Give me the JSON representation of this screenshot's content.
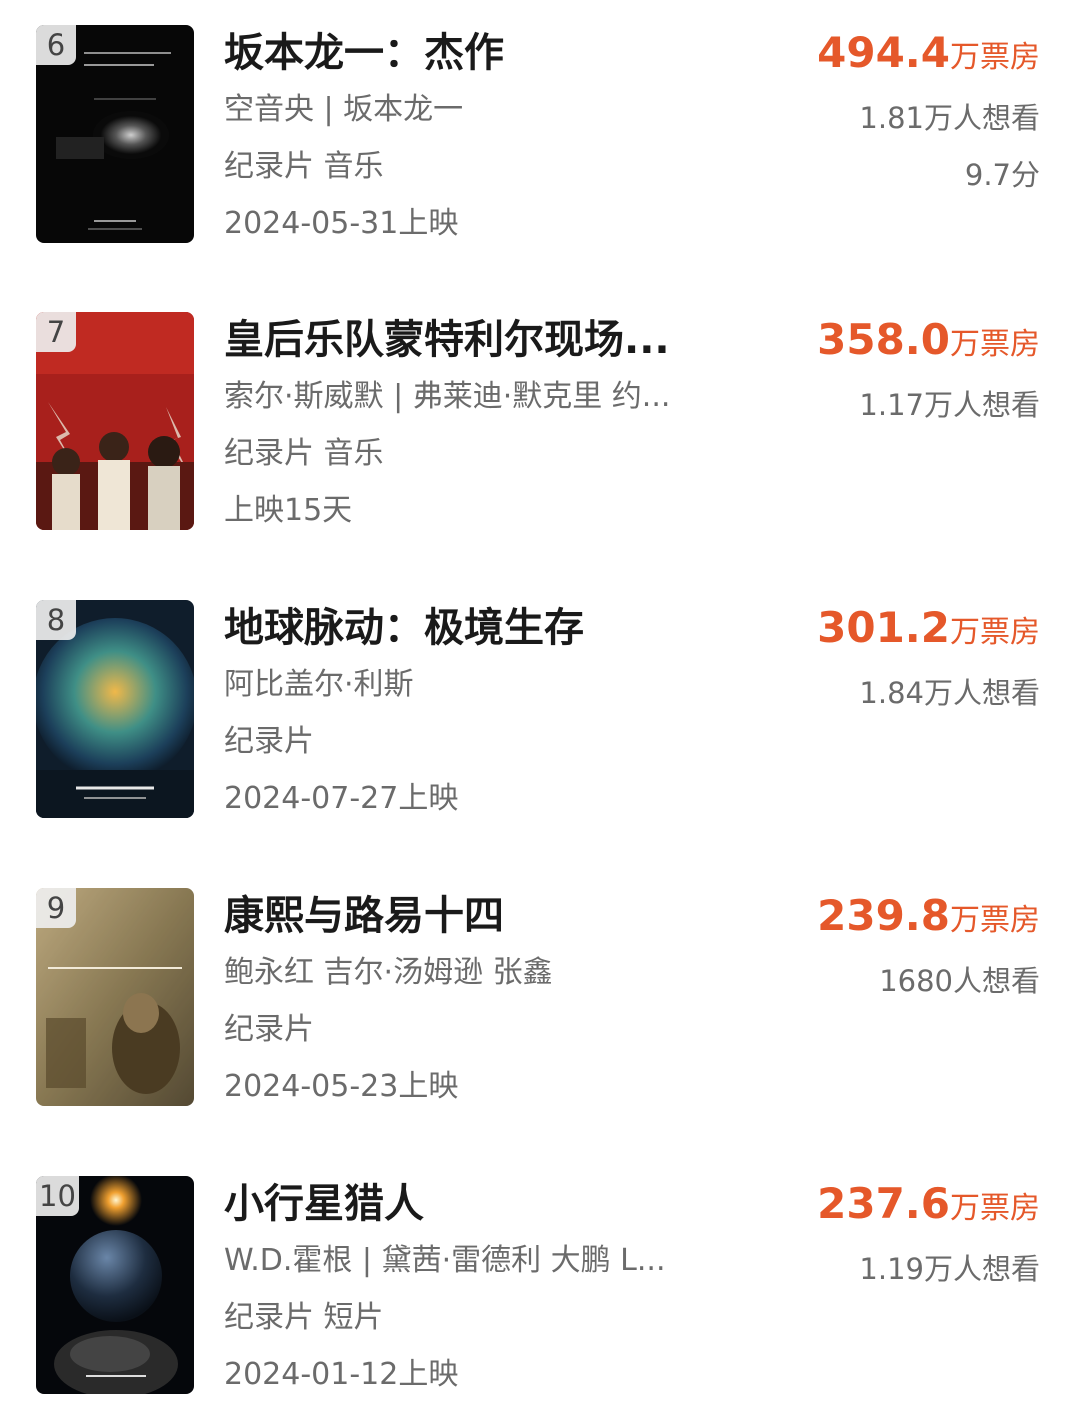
{
  "colors": {
    "accent": "#e5582a",
    "text_secondary": "#6b6b6b",
    "title": "#1a1a1a"
  },
  "movies": [
    {
      "rank": "6",
      "title": "坂本龙一：杰作",
      "people": "空音央 | 坂本龙一",
      "genre": "纪录片 音乐",
      "release": "2024-05-31上映",
      "box_office": "494.4",
      "box_office_unit": "万票房",
      "want": "1.81万人想看",
      "score": "9.7分",
      "poster_icon": "poster-ryuichi-sakamoto-opus"
    },
    {
      "rank": "7",
      "title": "皇后乐队蒙特利尔现场...",
      "people": "索尔·斯威默 | 弗莱迪·默克里 约...",
      "genre": "纪录片 音乐",
      "release": "上映15天",
      "box_office": "358.0",
      "box_office_unit": "万票房",
      "want": "1.17万人想看",
      "score": "",
      "poster_icon": "poster-queen-rock-montreal"
    },
    {
      "rank": "8",
      "title": "地球脉动：极境生存",
      "people": "阿比盖尔·利斯",
      "genre": "纪录片",
      "release": "2024-07-27上映",
      "box_office": "301.2",
      "box_office_unit": "万票房",
      "want": "1.84万人想看",
      "score": "",
      "poster_icon": "poster-planet-earth"
    },
    {
      "rank": "9",
      "title": "康熙与路易十四",
      "people": "鲍永红 吉尔·汤姆逊 张鑫",
      "genre": "纪录片",
      "release": "2024-05-23上映",
      "box_office": "239.8",
      "box_office_unit": "万票房",
      "want": "1680人想看",
      "score": "",
      "poster_icon": "poster-kangxi-louis-xiv"
    },
    {
      "rank": "10",
      "title": "小行星猎人",
      "people": "W.D.霍根 | 黛茜·雷德利 大鹏 L...",
      "genre": "纪录片 短片",
      "release": "2024-01-12上映",
      "box_office": "237.6",
      "box_office_unit": "万票房",
      "want": "1.19万人想看",
      "score": "",
      "poster_icon": "poster-asteroid-hunters"
    }
  ]
}
